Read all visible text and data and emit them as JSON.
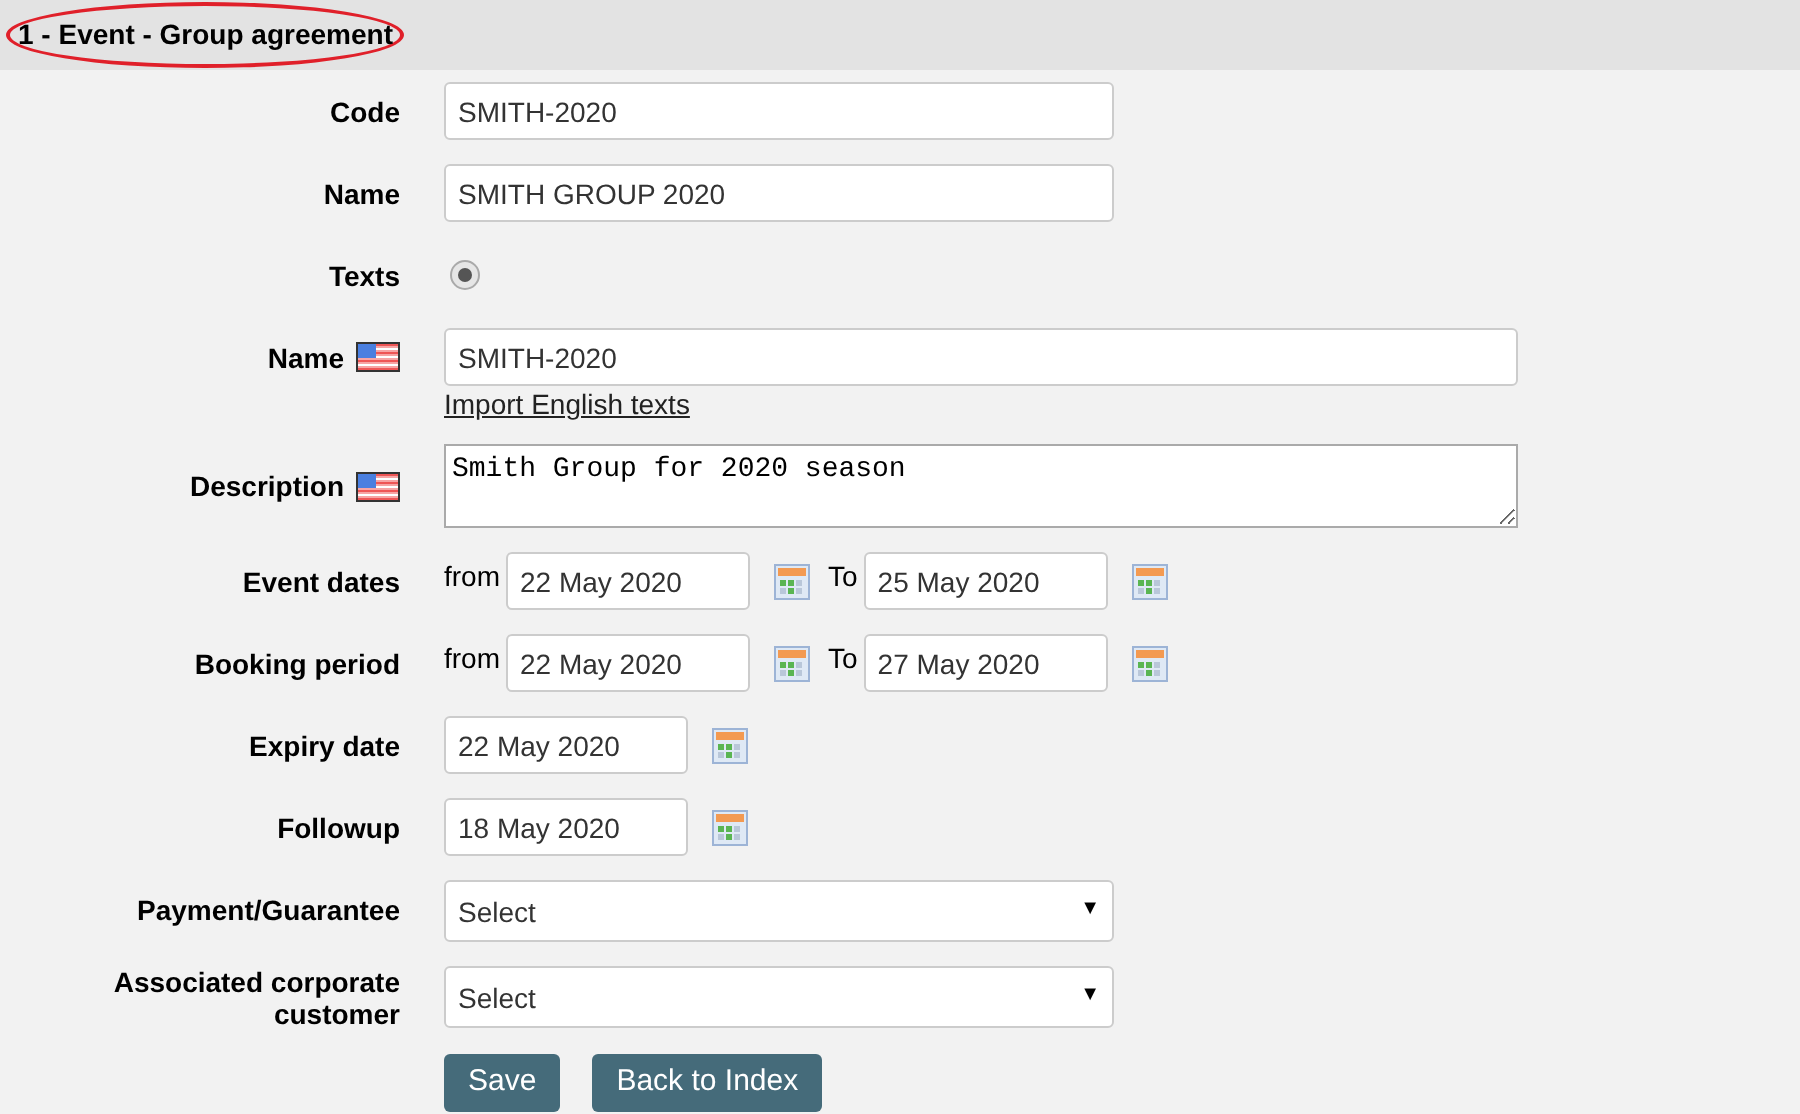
{
  "header": {
    "title": "1 - Event - Group agreement"
  },
  "fields": [
    {
      "kind": "text",
      "label": "Code",
      "value": "SMITH-2020"
    },
    {
      "kind": "text",
      "label": "Name",
      "value": "SMITH GROUP 2020"
    },
    {
      "kind": "radio",
      "label": "Texts",
      "selected": true
    },
    {
      "kind": "text_flag",
      "label": "Name",
      "value": "SMITH-2020",
      "link": "Import English texts"
    },
    {
      "kind": "textarea_flag",
      "label": "Description",
      "value": "Smith Group for 2020 season"
    },
    {
      "kind": "date_range",
      "label": "Event dates",
      "from_label": "from",
      "from": "22 May 2020",
      "to_label": "To",
      "to": "25 May 2020"
    },
    {
      "kind": "date_range",
      "label": "Booking period",
      "from_label": "from",
      "from": "22 May 2020",
      "to_label": "To",
      "to": "27 May 2020"
    },
    {
      "kind": "date",
      "label": "Expiry date",
      "value": "22 May 2020"
    },
    {
      "kind": "date",
      "label": "Followup",
      "value": "18 May 2020"
    },
    {
      "kind": "select",
      "label": "Payment/Guarantee",
      "value": "Select",
      "arrow": "▼"
    },
    {
      "kind": "select",
      "label": "Associated corporate customer",
      "value": "Select",
      "arrow": "▼"
    }
  ],
  "buttons": [
    "Save",
    "Back to Index"
  ]
}
